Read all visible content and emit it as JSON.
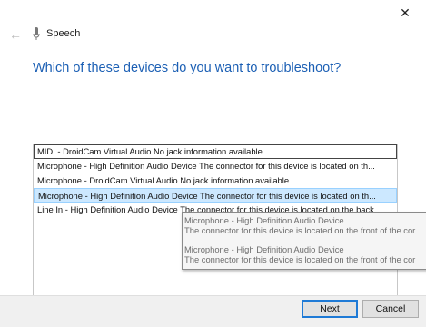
{
  "window": {
    "close_glyph": "✕",
    "back_glyph": "←",
    "app_title": "Speech"
  },
  "main": {
    "heading": "Which of these devices do you want to troubleshoot?"
  },
  "devices": [
    {
      "label": "MIDI - DroidCam Virtual Audio No jack information available.",
      "state": "focused"
    },
    {
      "label": "Microphone - High Definition Audio Device The connector for this device is located on th...",
      "state": "normal"
    },
    {
      "label": "Microphone - DroidCam Virtual Audio No jack information available.",
      "state": "normal"
    },
    {
      "label": "Microphone - High Definition Audio Device The connector for this device is located on th...",
      "state": "selected"
    },
    {
      "label": "Line In - High Definition Audio Device The connector for this device is located on the back...",
      "state": "normal"
    }
  ],
  "tooltip": {
    "entry1_title": "Microphone - High Definition Audio Device",
    "entry1_detail": "The connector for this device is located on the front of the cor",
    "entry2_title": "Microphone - High Definition Audio Device",
    "entry2_detail": "The connector for this device is located on the front of the cor"
  },
  "footer": {
    "next_label": "Next",
    "cancel_label": "Cancel"
  },
  "colors": {
    "heading": "#1b5fb4",
    "selection": "#cce8ff",
    "primary_button_border": "#1e7ad6"
  }
}
